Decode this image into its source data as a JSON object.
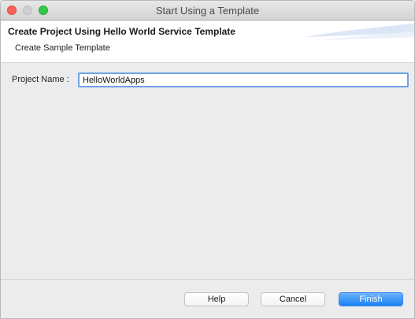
{
  "window": {
    "title": "Start Using a Template"
  },
  "banner": {
    "title": "Create Project Using Hello World Service Template",
    "subtitle": "Create Sample Template"
  },
  "form": {
    "project_name_label": "Project Name :",
    "project_name_value": "HelloWorldApps"
  },
  "buttons": {
    "help": "Help",
    "cancel": "Cancel",
    "finish": "Finish"
  },
  "colors": {
    "accent": "#1b82f6",
    "focus_ring": "#6ea2e7",
    "close": "#fc605b",
    "maximize": "#34c84a"
  }
}
